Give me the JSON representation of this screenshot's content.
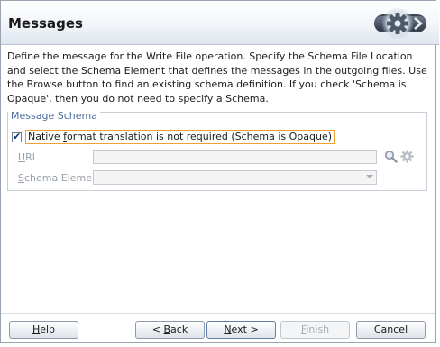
{
  "header": {
    "title": "Messages",
    "icon": "gear-wizard-icon"
  },
  "description": "Define the message for the Write File operation.  Specify the Schema File Location and select the Schema Element that defines the messages in the outgoing files. Use the Browse button to find an existing schema definition. If you check 'Schema is Opaque', then you do not need to specify a Schema.",
  "message_schema": {
    "legend": "Message Schema",
    "opaque_checkbox": {
      "label_pre": "Native ",
      "label_underlined": "f",
      "label_post": "ormat translation is not required (Schema is Opaque)",
      "checked": true
    },
    "url": {
      "label_underlined": "U",
      "label_rest": "RL",
      "value": "",
      "enabled": false
    },
    "schema_element": {
      "label_underlined": "S",
      "label_rest": "chema Element",
      "value": "",
      "enabled": false
    },
    "browse_icon": "search-icon",
    "settings_icon": "gear-icon"
  },
  "buttons": {
    "help_underlined": "H",
    "help_rest": "elp",
    "back_prefix": "< ",
    "back_underlined": "B",
    "back_rest": "ack",
    "next_underlined": "N",
    "next_rest": "ext >",
    "finish_underlined": "F",
    "finish_rest": "inish",
    "cancel": "Cancel"
  }
}
